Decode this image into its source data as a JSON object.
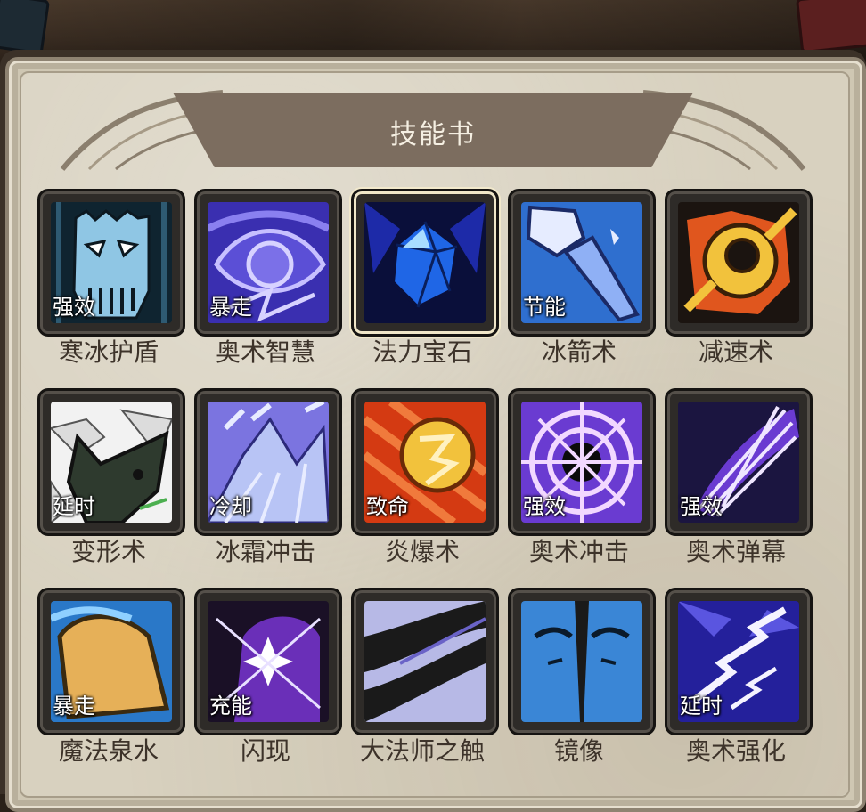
{
  "panel": {
    "title": "技能书"
  },
  "skills": [
    {
      "name": "寒冰护盾",
      "tag": "强效",
      "icon": "frost-skull-icon"
    },
    {
      "name": "奥术智慧",
      "tag": "暴走",
      "icon": "arcane-eye-icon"
    },
    {
      "name": "法力宝石",
      "tag": "",
      "icon": "mana-gem-icon",
      "selected": true
    },
    {
      "name": "冰箭术",
      "tag": "节能",
      "icon": "ice-shard-icon"
    },
    {
      "name": "减速术",
      "tag": "",
      "icon": "chain-ring-icon"
    },
    {
      "name": "变形术",
      "tag": "延时",
      "icon": "polymorph-cat-icon"
    },
    {
      "name": "冰霜冲击",
      "tag": "冷却",
      "icon": "frost-nova-icon"
    },
    {
      "name": "炎爆术",
      "tag": "致命",
      "icon": "pyroblast-icon"
    },
    {
      "name": "奥术冲击",
      "tag": "强效",
      "icon": "arcane-blast-icon"
    },
    {
      "name": "奥术弹幕",
      "tag": "强效",
      "icon": "arcane-barrage-icon"
    },
    {
      "name": "魔法泉水",
      "tag": "暴走",
      "icon": "magic-water-icon"
    },
    {
      "name": "闪现",
      "tag": "充能",
      "icon": "blink-star-icon"
    },
    {
      "name": "大法师之触",
      "tag": "",
      "icon": "archmage-touch-icon"
    },
    {
      "name": "镜像",
      "tag": "",
      "icon": "mirror-image-icon"
    },
    {
      "name": "奥术强化",
      "tag": "延时",
      "icon": "arcane-power-icon"
    }
  ]
}
